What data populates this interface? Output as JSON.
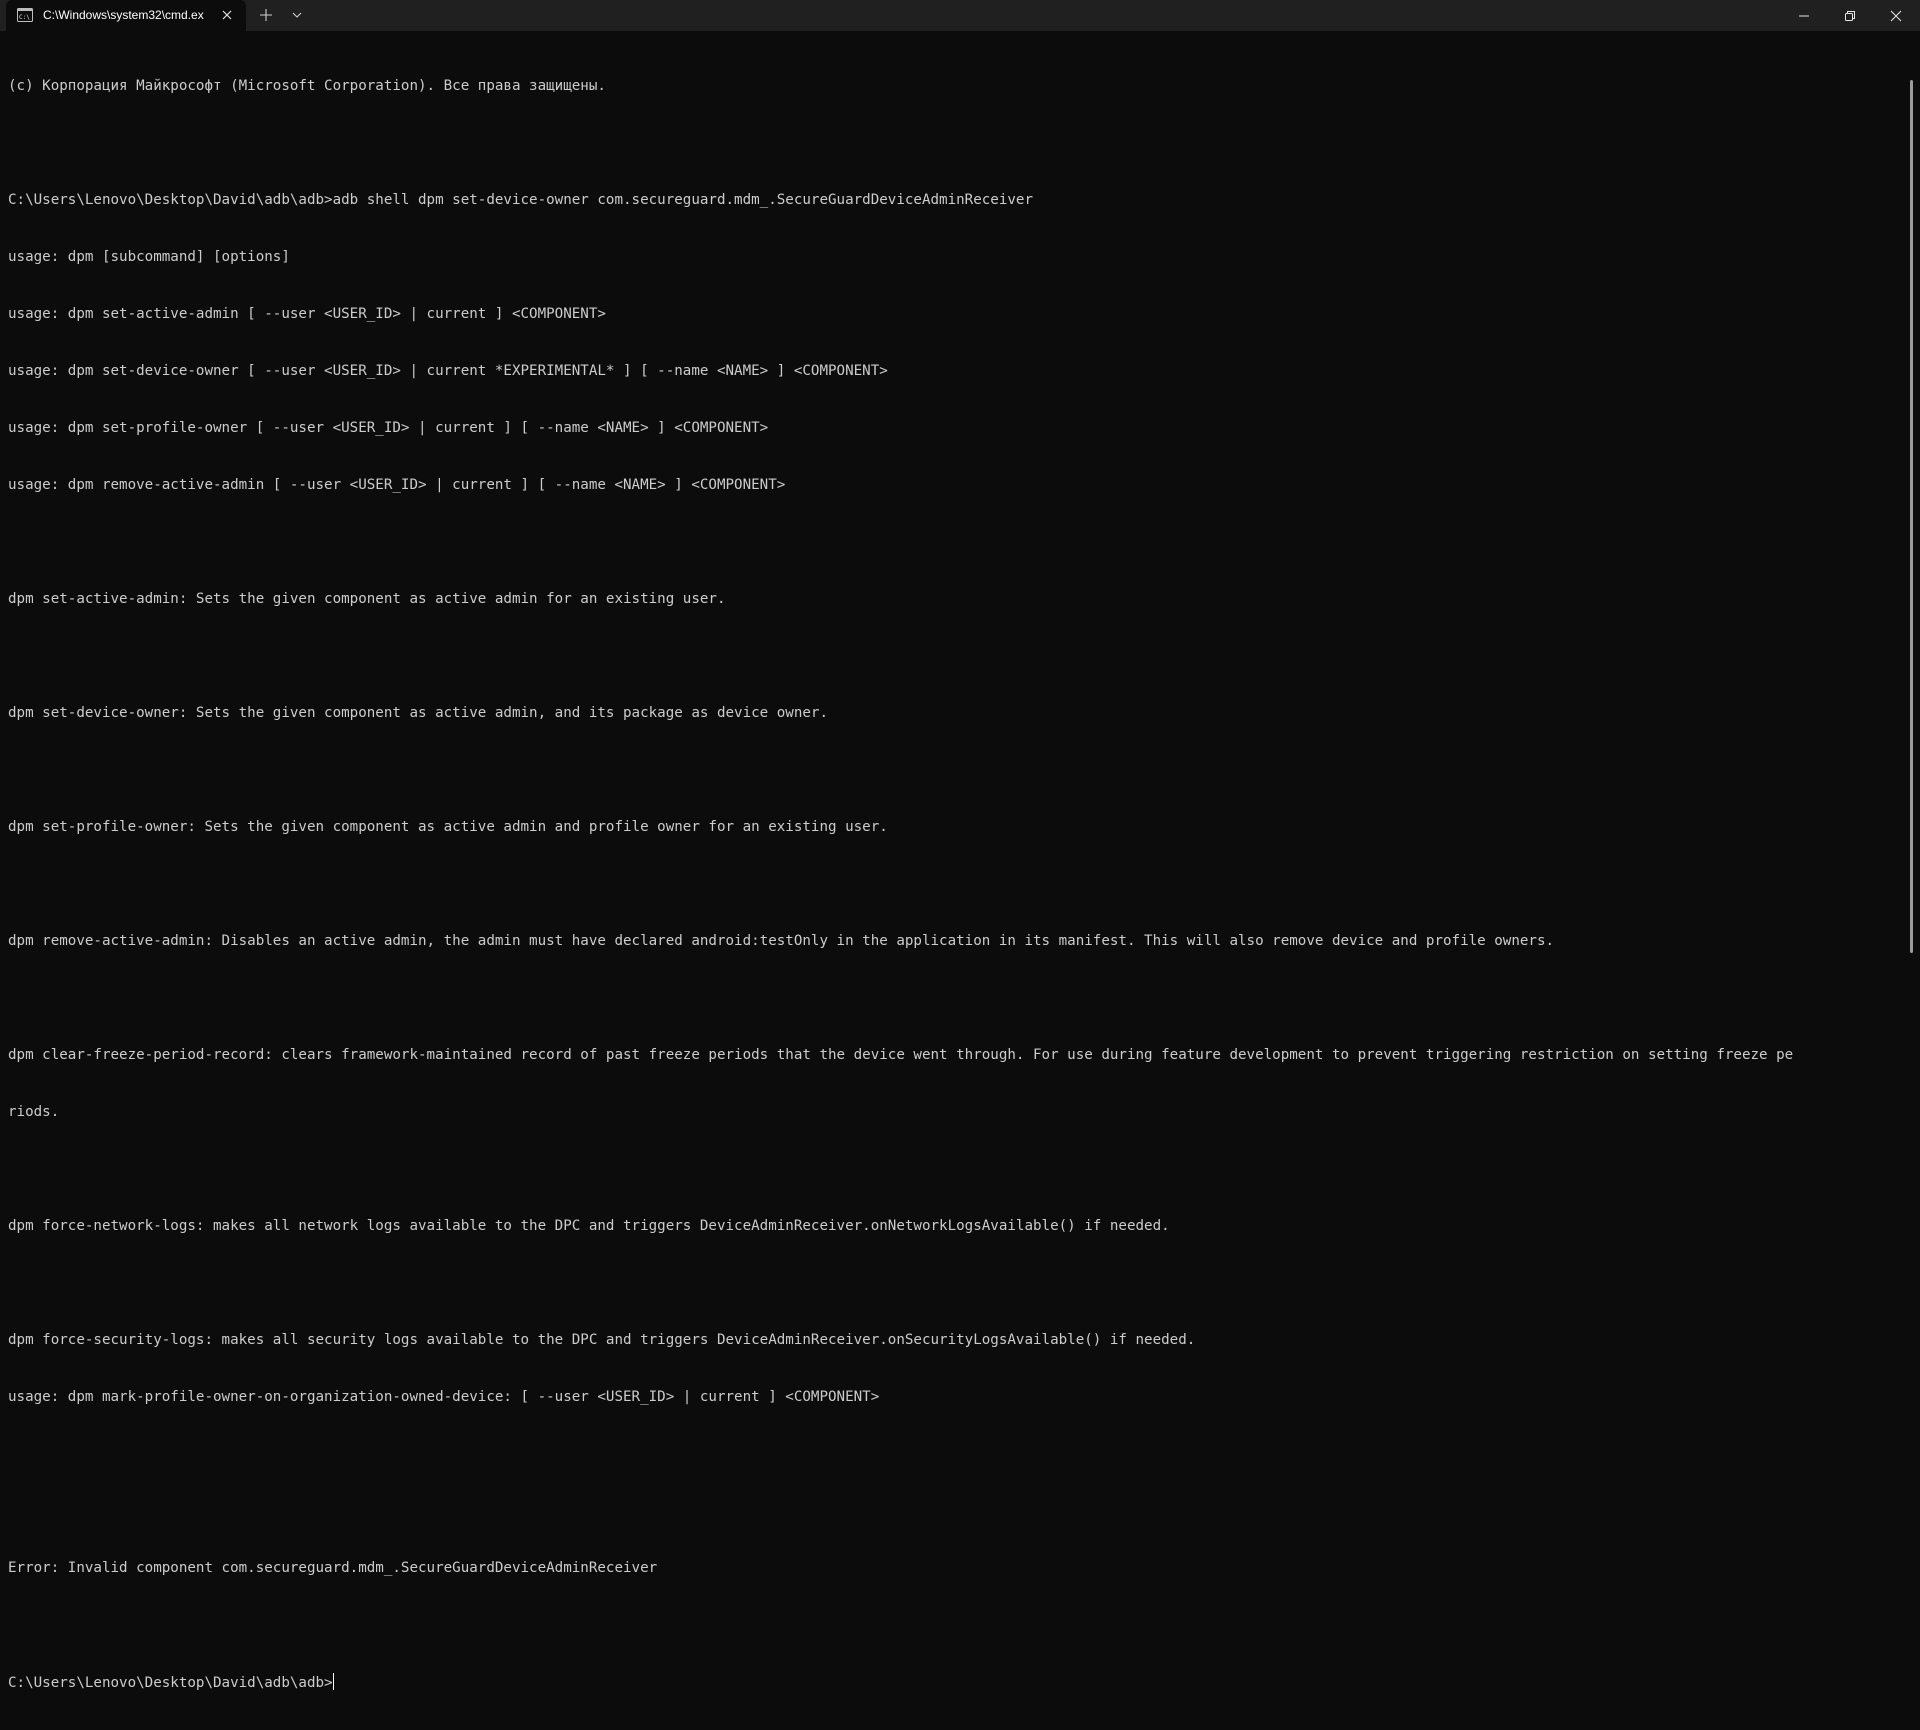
{
  "window": {
    "tab_title": "C:\\Windows\\system32\\cmd.ex",
    "icons": {
      "tab": "cmd-terminal-icon",
      "tab_close": "close-icon",
      "new_tab": "plus-icon",
      "dropdown": "chevron-down-icon",
      "minimize": "minimize-icon",
      "maximize": "restore-icon",
      "close": "close-icon"
    },
    "colors": {
      "titlebar": "#202020",
      "background": "#0c0c0c",
      "text": "#cccccc"
    }
  },
  "terminal": {
    "lines": [
      "(c) Корпорация Майкрософт (Microsoft Corporation). Все права защищены.",
      "",
      "C:\\Users\\Lenovo\\Desktop\\David\\adb\\adb>adb shell dpm set-device-owner com.secureguard.mdm_.SecureGuardDeviceAdminReceiver",
      "usage: dpm [subcommand] [options]",
      "usage: dpm set-active-admin [ --user <USER_ID> | current ] <COMPONENT>",
      "usage: dpm set-device-owner [ --user <USER_ID> | current *EXPERIMENTAL* ] [ --name <NAME> ] <COMPONENT>",
      "usage: dpm set-profile-owner [ --user <USER_ID> | current ] [ --name <NAME> ] <COMPONENT>",
      "usage: dpm remove-active-admin [ --user <USER_ID> | current ] [ --name <NAME> ] <COMPONENT>",
      "",
      "dpm set-active-admin: Sets the given component as active admin for an existing user.",
      "",
      "dpm set-device-owner: Sets the given component as active admin, and its package as device owner.",
      "",
      "dpm set-profile-owner: Sets the given component as active admin and profile owner for an existing user.",
      "",
      "dpm remove-active-admin: Disables an active admin, the admin must have declared android:testOnly in the application in its manifest. This will also remove device and profile owners.",
      "",
      "dpm clear-freeze-period-record: clears framework-maintained record of past freeze periods that the device went through. For use during feature development to prevent triggering restriction on setting freeze pe",
      "riods.",
      "",
      "dpm force-network-logs: makes all network logs available to the DPC and triggers DeviceAdminReceiver.onNetworkLogsAvailable() if needed.",
      "",
      "dpm force-security-logs: makes all security logs available to the DPC and triggers DeviceAdminReceiver.onSecurityLogsAvailable() if needed.",
      "usage: dpm mark-profile-owner-on-organization-owned-device: [ --user <USER_ID> | current ] <COMPONENT>",
      "",
      "",
      "Error: Invalid component com.secureguard.mdm_.SecureGuardDeviceAdminReceiver",
      ""
    ],
    "prompt": "C:\\Users\\Lenovo\\Desktop\\David\\adb\\adb>"
  }
}
